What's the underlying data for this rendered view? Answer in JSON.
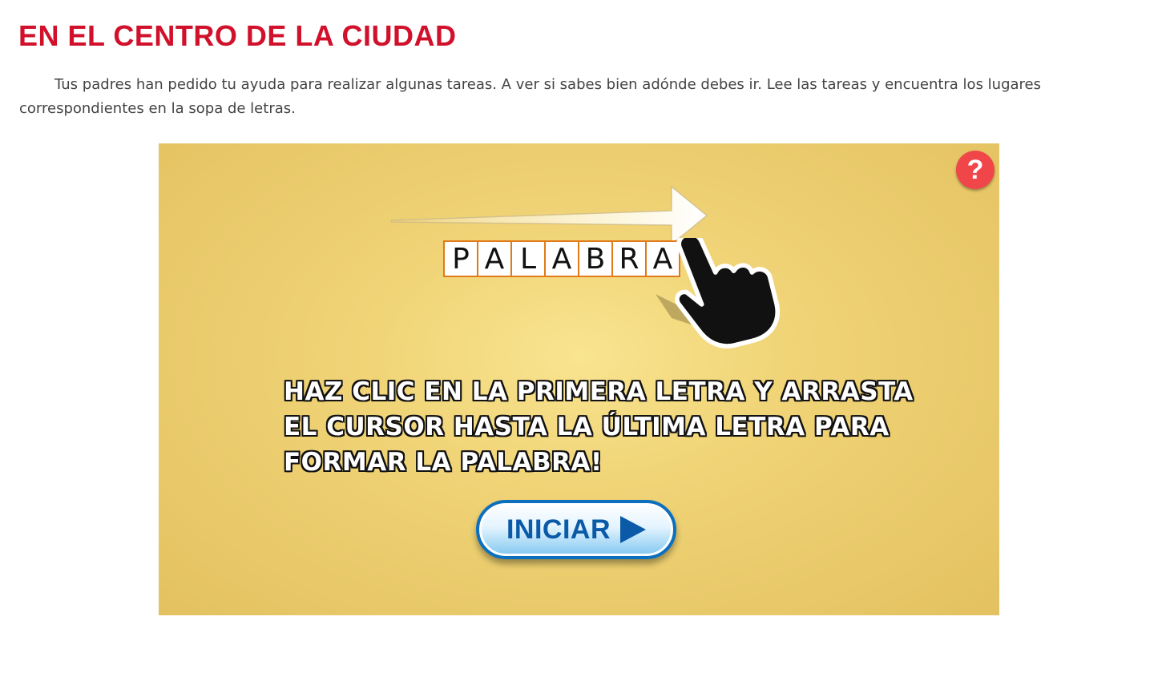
{
  "page": {
    "title": "EN EL CENTRO DE LA CIUDAD",
    "intro": "Tus padres han pedido tu ayuda para realizar algunas tareas. A ver si sabes bien adónde debes ir. Lee las tareas y encuentra los lugares correspondientes en la sopa de letras."
  },
  "game": {
    "help_label": "?",
    "word_letters": [
      "P",
      "A",
      "L",
      "A",
      "B",
      "R",
      "A"
    ],
    "instruction": "HAZ CLIC EN LA PRIMERA LETRA Y ARRASTA EL CURSOR HASTA LA ÚLTIMA LETRA PARA FORMAR LA PALABRA!",
    "start_label": "INICIAR",
    "colors": {
      "title": "#d1112b",
      "background": "#f0d477",
      "help_button": "#f0464a",
      "letter_border": "#e07a1a",
      "start_text": "#0a5aa8"
    },
    "icons": [
      "question-icon",
      "arrow-right-icon",
      "pointing-hand-icon",
      "play-icon"
    ]
  }
}
